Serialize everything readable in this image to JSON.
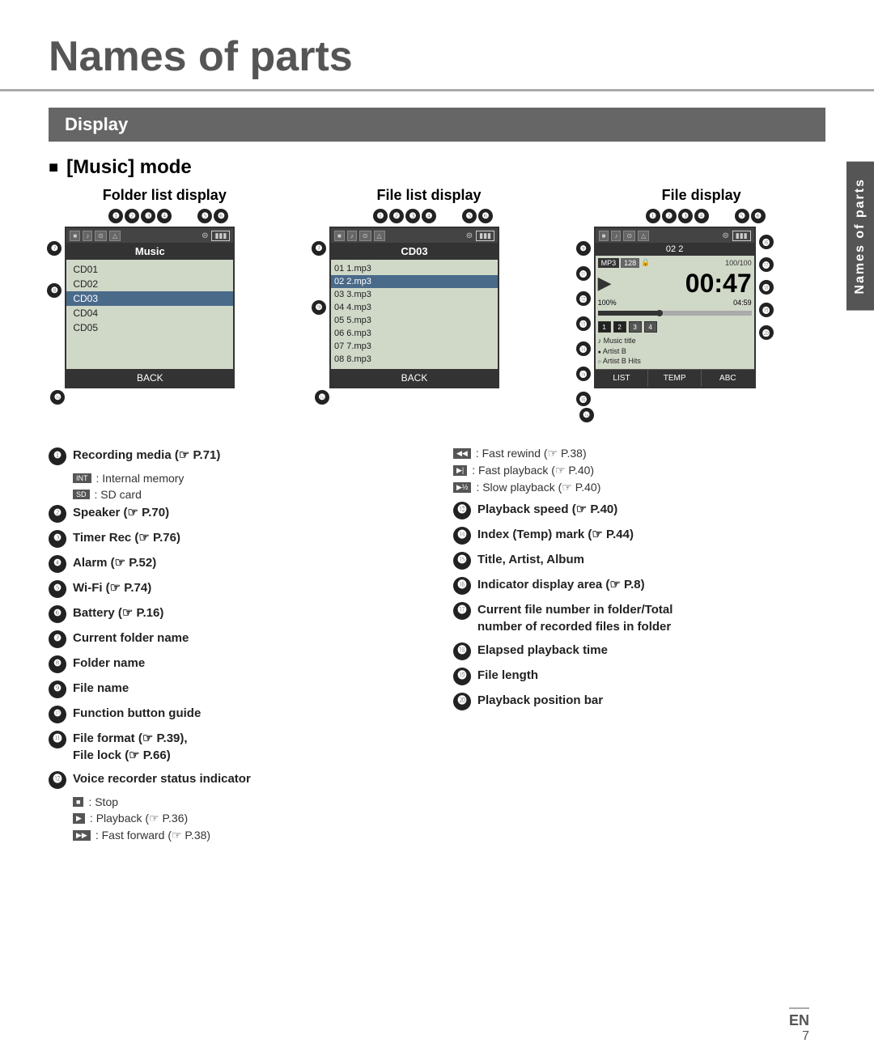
{
  "page": {
    "title": "Names of parts",
    "section": "Display",
    "mode": "[Music] mode",
    "side_label": "Names of parts",
    "en_label": "EN",
    "page_number": "7"
  },
  "diagrams": [
    {
      "title": "Folder list display",
      "type": "folder_list",
      "top_callouts": [
        "❶",
        "❷",
        "❸",
        "❹",
        "❺",
        "❻"
      ],
      "left_callouts": [
        "❼",
        "❽"
      ],
      "bottom_callout": "❿",
      "header_text": "Music",
      "items": [
        "CD01",
        "CD02",
        "CD03",
        "CD04",
        "CD05"
      ],
      "selected_index": 2,
      "back_label": "BACK"
    },
    {
      "title": "File list display",
      "type": "file_list",
      "top_callouts": [
        "❶",
        "❷",
        "❸",
        "❹",
        "❺",
        "❻"
      ],
      "left_callouts": [
        "❼",
        "❾"
      ],
      "bottom_callout": "❿",
      "header_text": "CD03",
      "items": [
        "01 1.mp3",
        "02 2.mp3",
        "03 3.mp3",
        "04 4.mp3",
        "05 5.mp3",
        "06 6.mp3",
        "07 7.mp3",
        "08 8.mp3"
      ],
      "selected_index": 1,
      "back_label": "BACK"
    },
    {
      "title": "File display",
      "type": "file_display",
      "top_callouts": [
        "❶",
        "❷",
        "❸",
        "❹",
        "❺",
        "❻"
      ],
      "left_callouts_right": [
        "❾",
        "❿",
        "⓫",
        "⓬",
        "⓭",
        "⓮",
        "⓯",
        "⓰"
      ],
      "right_callouts": [
        "⓰",
        "⓱",
        "⓲",
        "⓳",
        "⓴"
      ],
      "header_text": "02  2",
      "mp3_label": "MP3 128",
      "file_count": "100/100",
      "playback_time": "00:47",
      "speed_pct": "100%",
      "file_length": "04:59",
      "music_title": "Music title",
      "artist1": "Artist B",
      "album": "Artist B Hits",
      "tabs": [
        "LIST",
        "TEMP",
        "ABC"
      ],
      "bottom_callout": "❿"
    }
  ],
  "annotations": {
    "left": [
      {
        "num": "❶",
        "text": "Recording media (☞ P.71)",
        "bold": true,
        "subs": [
          {
            "icon": "INT",
            "text": ": Internal memory"
          },
          {
            "icon": "SD",
            "text": ": SD card"
          }
        ]
      },
      {
        "num": "❷",
        "text": "Speaker (☞ P.70)",
        "bold": true
      },
      {
        "num": "❸",
        "text": "Timer Rec (☞ P.76)",
        "bold": true
      },
      {
        "num": "❹",
        "text": "Alarm (☞ P.52)",
        "bold": true
      },
      {
        "num": "❺",
        "text": "Wi-Fi (☞ P.74)",
        "bold": true
      },
      {
        "num": "❻",
        "text": "Battery (☞ P.16)",
        "bold": true
      },
      {
        "num": "❼",
        "text": "Current folder name",
        "bold": true
      },
      {
        "num": "❽",
        "text": "Folder name",
        "bold": true
      },
      {
        "num": "❾",
        "text": "File name",
        "bold": true
      },
      {
        "num": "❿",
        "text": "Function button guide",
        "bold": true
      },
      {
        "num": "⓫",
        "text": "File format (☞ P.39),",
        "bold": true,
        "text2": "File lock (☞ P.66)"
      },
      {
        "num": "⓬",
        "text": "Voice recorder status indicator",
        "bold": true,
        "subs": [
          {
            "icon": "■",
            "text": ": Stop"
          },
          {
            "icon": "▶",
            "text": ": Playback (☞ P.36)"
          },
          {
            "icon": "▶▶",
            "text": ": Fast forward (☞ P.38)"
          }
        ]
      }
    ],
    "right": [
      {
        "icon": "◀◀",
        "text": ": Fast rewind (☞ P.38)"
      },
      {
        "icon": "▶|",
        "text": ": Fast playback (☞ P.40)"
      },
      {
        "icon": "▶½",
        "text": ": Slow playback (☞ P.40)"
      },
      {
        "num": "⓭",
        "text": "Playback speed (☞ P.40)",
        "bold": true
      },
      {
        "num": "⓮",
        "text": "Index (Temp) mark (☞ P.44)",
        "bold": true
      },
      {
        "num": "⓯",
        "text": "Title, Artist, Album",
        "bold": true
      },
      {
        "num": "⓰",
        "text": "Indicator display area (☞ P.8)",
        "bold": true
      },
      {
        "num": "⓱",
        "text": "Current file number in folder/Total number of recorded files in folder",
        "bold": true
      },
      {
        "num": "⓲",
        "text": "Elapsed playback time",
        "bold": true
      },
      {
        "num": "⓳",
        "text": "File length",
        "bold": true
      },
      {
        "num": "⓴",
        "text": "Playback position bar",
        "bold": true
      }
    ]
  }
}
